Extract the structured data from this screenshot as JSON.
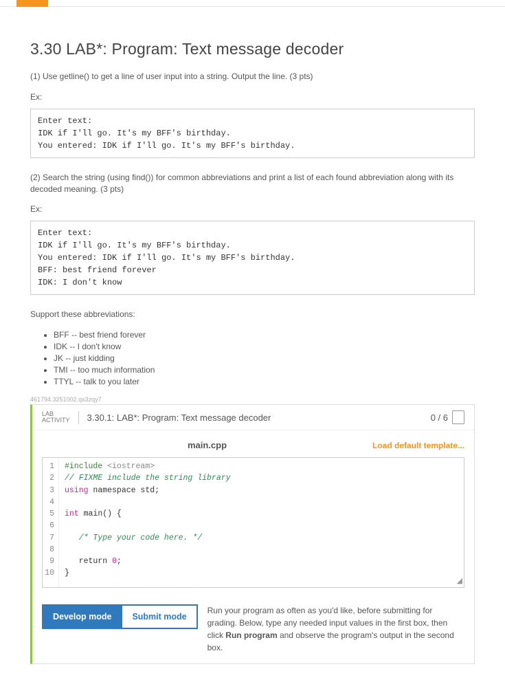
{
  "heading": "3.30 LAB*: Program: Text message decoder",
  "step1": "(1) Use getline() to get a line of user input into a string. Output the line. (3 pts)",
  "ex_label": "Ex:",
  "ex1": "Enter text:\nIDK if I'll go. It's my BFF's birthday.\nYou entered: IDK if I'll go. It's my BFF's birthday.",
  "step2": "(2) Search the string (using find()) for common abbreviations and print a list of each found abbreviation along with its decoded meaning. (3 pts)",
  "ex2": "Enter text:\nIDK if I'll go. It's my BFF's birthday.\nYou entered: IDK if I'll go. It's my BFF's birthday.\nBFF: best friend forever\nIDK: I don't know",
  "support_label": "Support these abbreviations:",
  "abbr": [
    "BFF -- best friend forever",
    "IDK -- I don't know",
    "JK -- just kidding",
    "TMI -- too much information",
    "TTYL -- talk to you later"
  ],
  "hash": "461794.3251002.qx3zqy7",
  "lab_badge_l1": "LAB",
  "lab_badge_l2": "ACTIVITY",
  "lab_title": "3.30.1: LAB*: Program: Text message decoder",
  "score": "0 / 6",
  "file_name": "main.cpp",
  "load_template": "Load default template...",
  "code": {
    "l1_a": "#include ",
    "l1_b": "<iostream>",
    "l2": "// FIXME include the string library",
    "l3_a": "using",
    "l3_b": " namespace std;",
    "l5_a": "int",
    "l5_b": " main() {",
    "l7": "   /* Type your code here. */",
    "l9_a": "   return ",
    "l9_b": "0",
    "l9_c": ";",
    "l10": "}"
  },
  "develop_btn": "Develop mode",
  "submit_btn": "Submit mode",
  "mode_help_a": "Run your program as often as you'd like, before submitting for grading. Below, type any needed input values in the first box, then click ",
  "mode_help_b": "Run program",
  "mode_help_c": " and observe the program's output in the second box."
}
